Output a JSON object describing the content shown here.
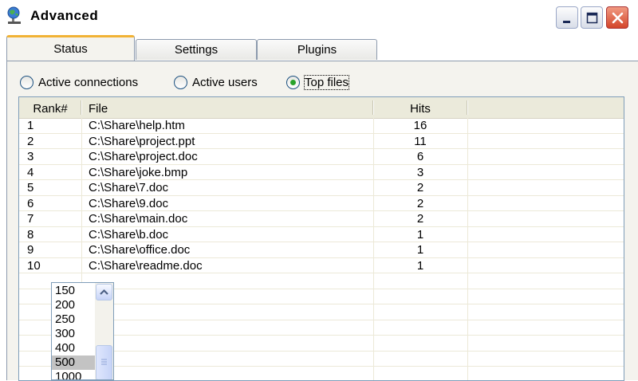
{
  "window": {
    "title": "Advanced",
    "icons": {
      "app": "network-globe-icon",
      "minimize": "minimize-icon",
      "maximize": "maximize-icon",
      "close": "close-icon"
    },
    "colors": {
      "tab_accent": "#f1b235",
      "radio_dot": "#29a32b",
      "close_button": "#d3452a",
      "panel_bg": "#f4f3ee"
    }
  },
  "tabs": [
    {
      "label": "Status",
      "active": true
    },
    {
      "label": "Settings",
      "active": false
    },
    {
      "label": "Plugins",
      "active": false
    }
  ],
  "view_mode": {
    "options": [
      {
        "label": "Active connections",
        "selected": false
      },
      {
        "label": "Active users",
        "selected": false
      },
      {
        "label": "Top files",
        "selected": true
      }
    ]
  },
  "table": {
    "columns": [
      "Rank#",
      "File",
      "Hits"
    ],
    "rows": [
      {
        "rank": "1",
        "file": "C:\\Share\\help.htm",
        "hits": "16"
      },
      {
        "rank": "2",
        "file": "C:\\Share\\project.ppt",
        "hits": "11"
      },
      {
        "rank": "3",
        "file": "C:\\Share\\project.doc",
        "hits": "6"
      },
      {
        "rank": "4",
        "file": "C:\\Share\\joke.bmp",
        "hits": "3"
      },
      {
        "rank": "5",
        "file": "C:\\Share\\7.doc",
        "hits": "2"
      },
      {
        "rank": "6",
        "file": "C:\\Share\\9.doc",
        "hits": "2"
      },
      {
        "rank": "7",
        "file": "C:\\Share\\main.doc",
        "hits": "2"
      },
      {
        "rank": "8",
        "file": "C:\\Share\\b.doc",
        "hits": "1"
      },
      {
        "rank": "9",
        "file": "C:\\Share\\office.doc",
        "hits": "1"
      },
      {
        "rank": "10",
        "file": "C:\\Share\\readme.doc",
        "hits": "1"
      }
    ]
  },
  "count_dropdown": {
    "options": [
      "150",
      "200",
      "250",
      "300",
      "400",
      "500",
      "1000"
    ],
    "selected": "500",
    "icons": {
      "scroll_up": "chevron-up-icon",
      "thumb": "grip-icon"
    }
  }
}
